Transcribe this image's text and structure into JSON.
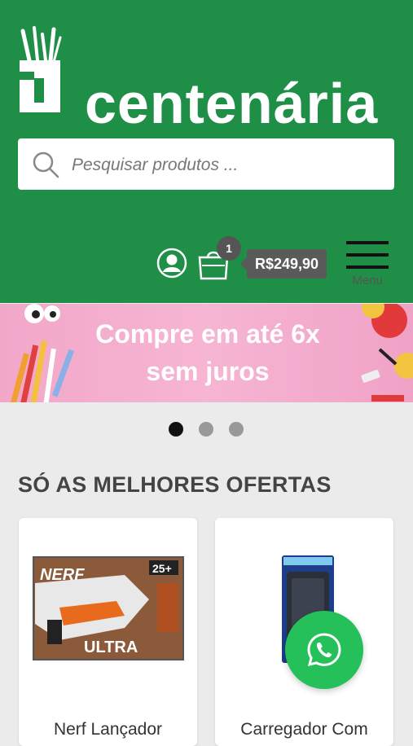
{
  "brand": {
    "name": "centenária"
  },
  "search": {
    "placeholder": "Pesquisar produtos ..."
  },
  "header": {
    "cart_count": "1",
    "cart_total": "R$249,90",
    "menu_label": "Menu"
  },
  "banner": {
    "line1": "Compre em até 6x",
    "line2": "sem juros"
  },
  "carousel": {
    "dots": 3,
    "active_index": 0
  },
  "section": {
    "title": "SÓ AS MELHORES OFERTAS"
  },
  "products": [
    {
      "title": "Nerf Lançador",
      "image": "nerf-ultra-box"
    },
    {
      "title": "Carregador Com",
      "image": "power-bank-box"
    }
  ],
  "colors": {
    "header_bg": "#1f8f48",
    "banner_bg": "#f6b5d3",
    "whatsapp": "#25c05a",
    "badge_bg": "#555555"
  }
}
